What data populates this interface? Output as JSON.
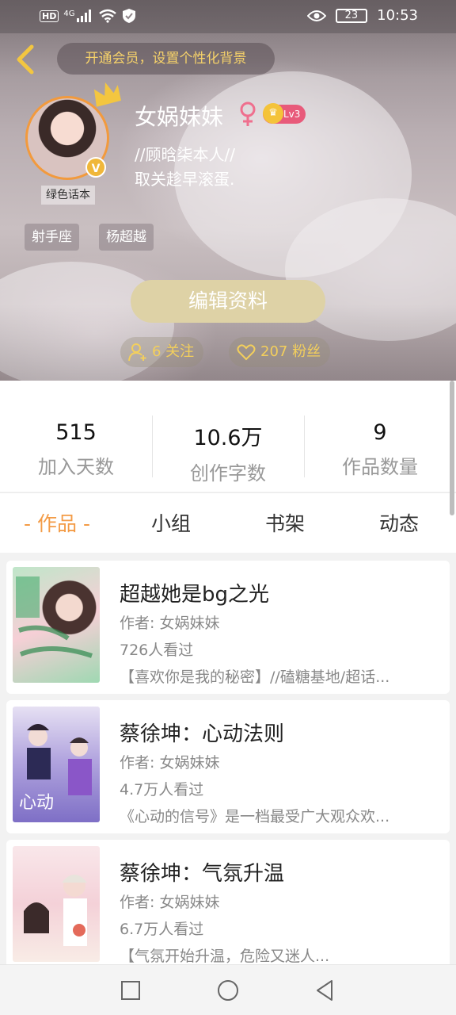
{
  "status_bar": {
    "network": "HD",
    "signal": "4G",
    "battery": "23",
    "time": "10:53"
  },
  "header": {
    "vip_banner": "开通会员，设置个性化背景"
  },
  "profile": {
    "nickname": "女娲妹妹",
    "level": "Lv3",
    "bio_line1": "//顾晗柒本人//",
    "bio_line2": "取关趁早滚蛋.",
    "avatar_caption": "绿色话本",
    "verified_badge": "V",
    "tags": [
      "射手座",
      "杨超越"
    ],
    "edit_button": "编辑资料",
    "following": "6 关注",
    "followers": "207 粉丝"
  },
  "stats": [
    {
      "value": "515",
      "label": "加入天数"
    },
    {
      "value": "10.6万",
      "label": "创作字数"
    },
    {
      "value": "9",
      "label": "作品数量"
    }
  ],
  "tabs": [
    "- 作品 -",
    "小组",
    "书架",
    "动态"
  ],
  "works": [
    {
      "title": "超越她是bg之光",
      "author": "作者: 女娲妹妹",
      "views": "726人看过",
      "desc": "【喜欢你是我的秘密】//磕糖基地/超话..."
    },
    {
      "title": "蔡徐坤：心动法则",
      "author": "作者: 女娲妹妹",
      "views": "4.7万人看过",
      "desc": "《心动的信号》是一档最受广大观众欢..."
    },
    {
      "title": "蔡徐坤：气氛升温",
      "author": "作者: 女娲妹妹",
      "views": "6.7万人看过",
      "desc": "【气氛开始升温，危险又迷人..."
    }
  ],
  "colors": {
    "accent": "#f39b46",
    "gold": "#f3cf5c",
    "edit_button": "#ded2a6"
  }
}
